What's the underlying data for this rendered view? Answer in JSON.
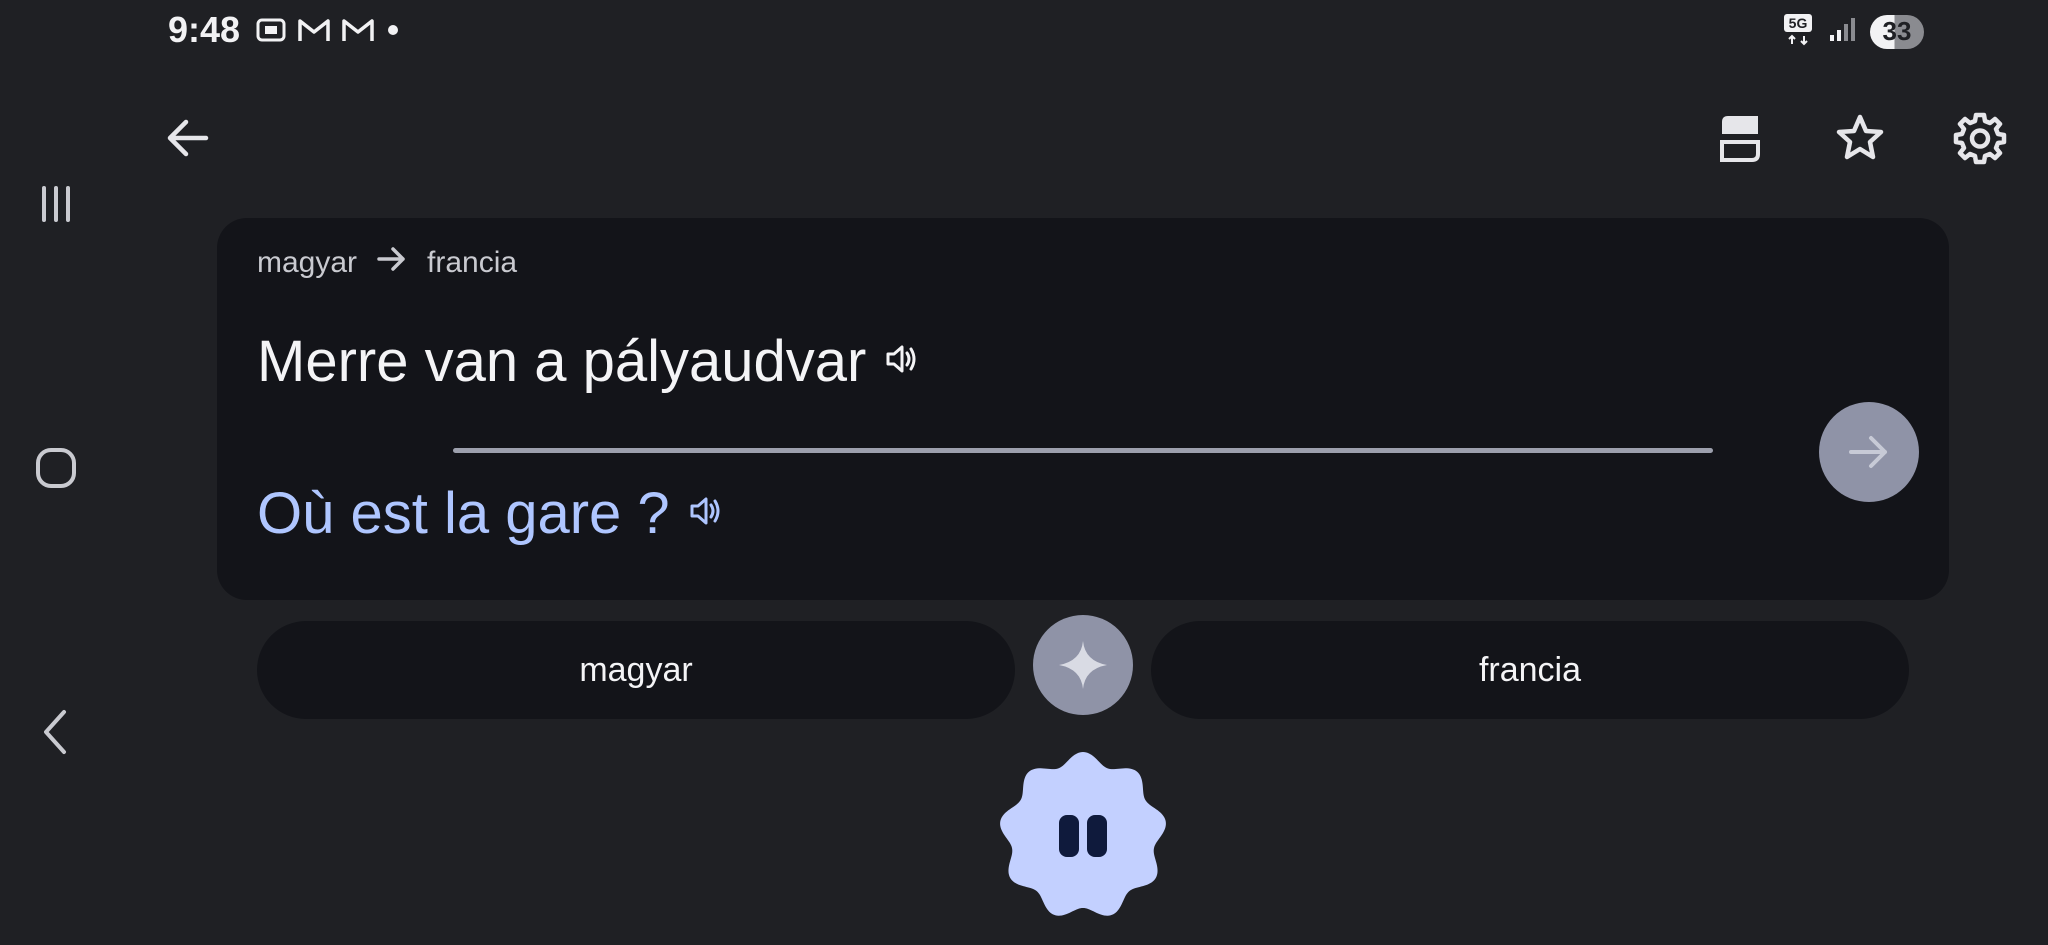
{
  "status_bar": {
    "time": "9:48",
    "network": "5G",
    "battery_level": "33"
  },
  "card": {
    "source_lang": "magyar",
    "target_lang": "francia",
    "source_text": "Merre van a pályaudvar",
    "translated_text": "Où est la gare ?"
  },
  "pills": {
    "left_label": "magyar",
    "right_label": "francia"
  },
  "colors": {
    "background": "#1f2024",
    "card": "#131419",
    "accent": "#afc6ff",
    "pause_fill": "#c3d0ff"
  }
}
